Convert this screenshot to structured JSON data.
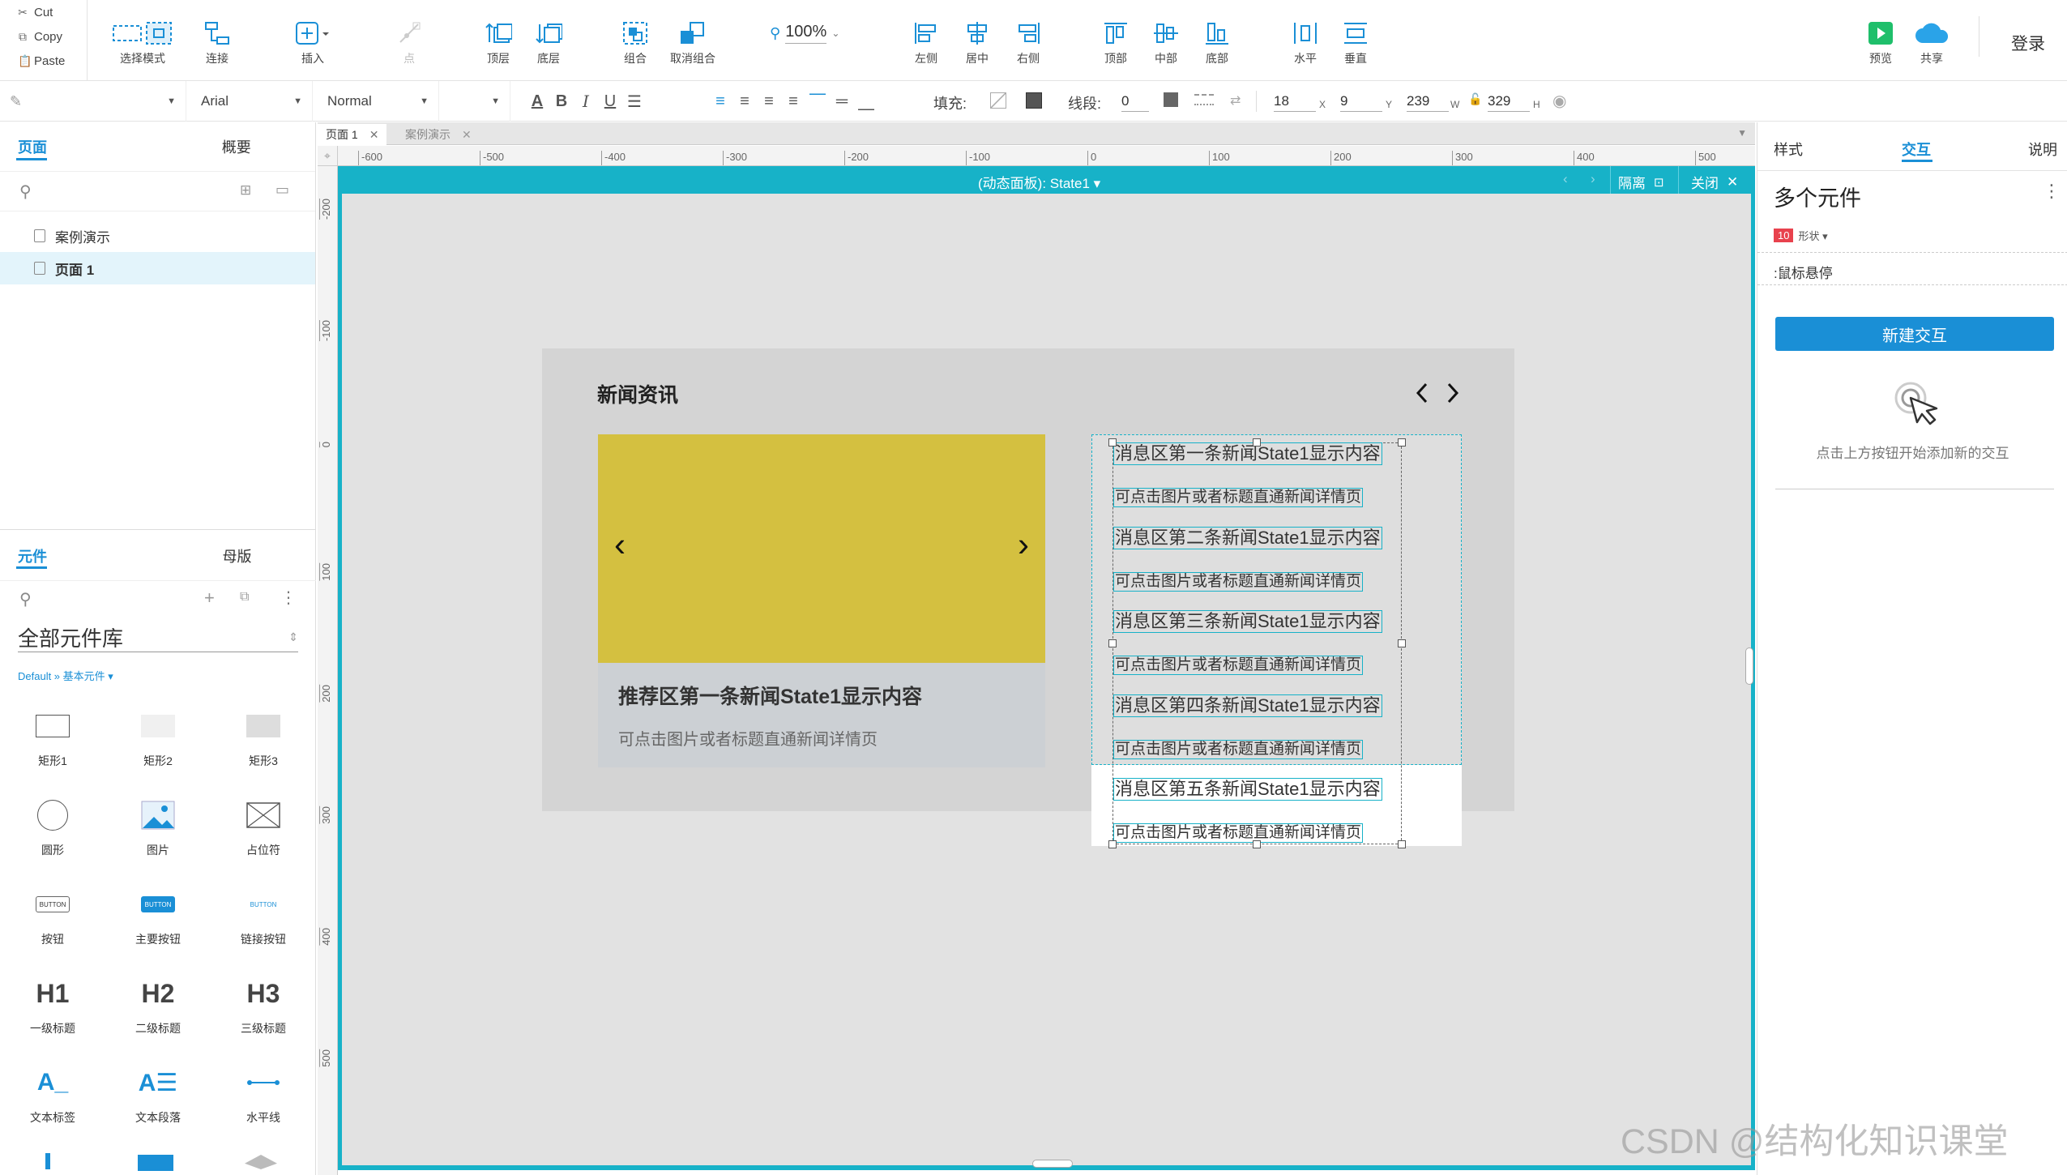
{
  "clipboard": {
    "cut": "Cut",
    "copy": "Copy",
    "paste": "Paste"
  },
  "toolbar": {
    "select_mode": "选择模式",
    "connect": "连接",
    "insert": "插入",
    "point": "点",
    "top_layer": "顶层",
    "bottom_layer": "底层",
    "group": "组合",
    "ungroup": "取消组合",
    "zoom": "100%",
    "align_left": "左侧",
    "align_center": "居中",
    "align_right": "右侧",
    "align_top": "顶部",
    "align_middle": "中部",
    "align_bottom": "底部",
    "distribute_h": "水平",
    "distribute_v": "垂直",
    "preview": "预览",
    "share": "共享",
    "login": "登录"
  },
  "format_bar": {
    "font_family": "Arial",
    "font_style": "Normal",
    "fill_label": "填充:",
    "stroke_label": "线段:",
    "stroke_value": "0",
    "x_value": "18",
    "x_label": "X",
    "y_value": "9",
    "y_label": "Y",
    "w_value": "239",
    "w_label": "W",
    "h_value": "329",
    "h_label": "H"
  },
  "left_panel": {
    "tabs": [
      "页面",
      "概要"
    ],
    "pages": [
      "案例演示",
      "页面 1"
    ],
    "lib_tabs": [
      "元件",
      "母版"
    ],
    "library_name": "全部元件库",
    "library_path": "Default » 基本元件 ▾",
    "widgets": [
      "矩形1",
      "矩形2",
      "矩形3",
      "圆形",
      "图片",
      "占位符",
      "按钮",
      "主要按钮",
      "链接按钮",
      "一级标题",
      "二级标题",
      "三级标题",
      "文本标签",
      "文本段落",
      "水平线"
    ],
    "button_text": "BUTTON",
    "h_labels": [
      "H1",
      "H2",
      "H3"
    ]
  },
  "canvas": {
    "page_tabs": [
      "页面 1",
      "案例演示"
    ],
    "ruler_h": [
      "-600",
      "-500",
      "-400",
      "-300",
      "-200",
      "-100",
      "0",
      "100",
      "200",
      "300",
      "400",
      "500"
    ],
    "ruler_v": [
      "-200",
      "-100",
      "0",
      "100",
      "200",
      "300",
      "400",
      "500"
    ],
    "dynamic_panel_label": "(动态面板): State1 ▾",
    "isolate": "隔离",
    "close": "关闭"
  },
  "news": {
    "title": "新闻资讯",
    "featured_title": "推荐区第一条新闻State1显示内容",
    "featured_sub": "可点击图片或者标题直通新闻详情页",
    "items": [
      {
        "title": "消息区第一条新闻State1显示内容",
        "sub": "可点击图片或者标题直通新闻详情页"
      },
      {
        "title": "消息区第二条新闻State1显示内容",
        "sub": "可点击图片或者标题直通新闻详情页"
      },
      {
        "title": "消息区第三条新闻State1显示内容",
        "sub": "可点击图片或者标题直通新闻详情页"
      },
      {
        "title": "消息区第四条新闻State1显示内容",
        "sub": "可点击图片或者标题直通新闻详情页"
      },
      {
        "title": "消息区第五条新闻State1显示内容",
        "sub": "可点击图片或者标题直通新闻详情页"
      }
    ]
  },
  "right_panel": {
    "tabs": [
      "样式",
      "交互",
      "说明"
    ],
    "heading": "多个元件",
    "badge_count": "10",
    "badge_label": "形状 ▾",
    "event": ":鼠标悬停",
    "new_interaction": "新建交互",
    "hint": "点击上方按钮开始添加新的交互"
  },
  "watermark": "CSDN @结构化知识课堂",
  "colors": {
    "accent": "#17b2c8",
    "blue": "#1a8fd6",
    "yellow": "#d4c040"
  }
}
